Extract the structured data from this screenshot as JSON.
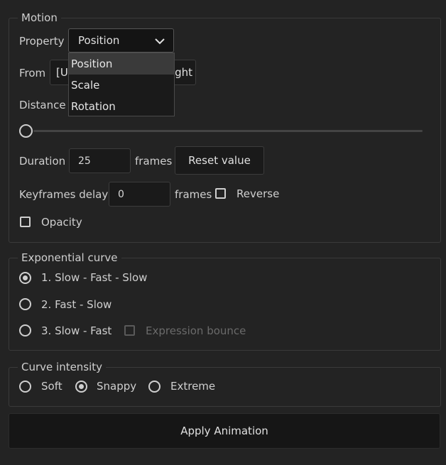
{
  "motion": {
    "legend": "Motion",
    "property_label": "Property",
    "property_selected": "Position",
    "property_options": [
      "Position",
      "Scale",
      "Rotation"
    ],
    "from_label": "From",
    "from_value_start": "[U",
    "from_value_end": "ght",
    "distance_label": "Distance",
    "distance_value": 0,
    "duration_label": "Duration",
    "duration_value": "25",
    "frames_label": "frames",
    "reset_label": "Reset value",
    "delay_label": "Keyframes delay",
    "delay_value": "0",
    "delay_frames_label": "frames",
    "reverse_label": "Reverse",
    "opacity_label": "Opacity"
  },
  "curve": {
    "legend": "Exponential curve",
    "options": [
      "1. Slow - Fast - Slow",
      "2. Fast - Slow",
      "3. Slow - Fast"
    ],
    "selected": 0,
    "bounce_label": "Expression bounce"
  },
  "intensity": {
    "legend": "Curve intensity",
    "options": [
      "Soft",
      "Snappy",
      "Extreme"
    ],
    "selected": 1
  },
  "apply_label": "Apply Animation"
}
